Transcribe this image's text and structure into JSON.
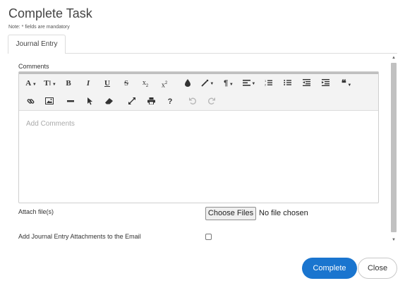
{
  "dialog": {
    "title": "Complete Task",
    "note": "Note: * fields are mandatory"
  },
  "tabs": [
    {
      "label": "Journal Entry",
      "active": true
    }
  ],
  "form": {
    "comments_label": "Comments",
    "comments_placeholder": "Add Comments",
    "attach_label": "Attach file(s)",
    "choose_files_label": "Choose Files",
    "no_file_text": "No file chosen",
    "email_attachments_label": "Add Journal Entry Attachments to the Email",
    "email_attachments_checked": false
  },
  "toolbar": {
    "font_family": "A",
    "font_size": "T",
    "bold": "B",
    "italic": "I",
    "underline": "U",
    "strikethrough": "S",
    "subscript": "x",
    "subscript_mark": "2",
    "superscript": "x",
    "superscript_mark": "2",
    "paragraph": "¶",
    "help": "?"
  },
  "actions": {
    "complete_label": "Complete",
    "close_label": "Close"
  },
  "colors": {
    "primary": "#1a75cf",
    "toolbar_bg": "#f3f3f3",
    "border": "#cfcfcf"
  }
}
